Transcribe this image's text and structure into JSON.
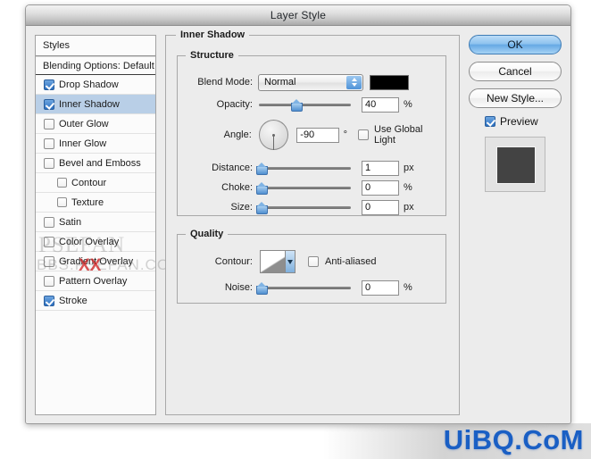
{
  "window": {
    "title": "Layer Style"
  },
  "sidebar": {
    "header": "Styles",
    "blending_options": "Blending Options: Default",
    "items": [
      {
        "label": "Drop Shadow",
        "checked": true,
        "selected": false,
        "indent": false
      },
      {
        "label": "Inner Shadow",
        "checked": true,
        "selected": true,
        "indent": false
      },
      {
        "label": "Outer Glow",
        "checked": false,
        "selected": false,
        "indent": false
      },
      {
        "label": "Inner Glow",
        "checked": false,
        "selected": false,
        "indent": false
      },
      {
        "label": "Bevel and Emboss",
        "checked": false,
        "selected": false,
        "indent": false
      },
      {
        "label": "Contour",
        "checked": false,
        "selected": false,
        "indent": true
      },
      {
        "label": "Texture",
        "checked": false,
        "selected": false,
        "indent": true
      },
      {
        "label": "Satin",
        "checked": false,
        "selected": false,
        "indent": false
      },
      {
        "label": "Color Overlay",
        "checked": false,
        "selected": false,
        "indent": false
      },
      {
        "label": "Gradient Overlay",
        "checked": false,
        "selected": false,
        "indent": false
      },
      {
        "label": "Pattern Overlay",
        "checked": false,
        "selected": false,
        "indent": false
      },
      {
        "label": "Stroke",
        "checked": true,
        "selected": false,
        "indent": false
      }
    ]
  },
  "panel": {
    "title": "Inner Shadow",
    "structure": {
      "legend": "Structure",
      "blend_mode_label": "Blend Mode:",
      "blend_mode_value": "Normal",
      "shadow_color": "#000000",
      "opacity_label": "Opacity:",
      "opacity_value": "40",
      "opacity_unit": "%",
      "opacity_percent": 40,
      "angle_label": "Angle:",
      "angle_value": "-90",
      "angle_unit": "°",
      "angle_degrees": -90,
      "use_global_light_label": "Use Global Light",
      "use_global_light_checked": false,
      "distance_label": "Distance:",
      "distance_value": "1",
      "distance_unit": "px",
      "distance_percent": 0,
      "choke_label": "Choke:",
      "choke_value": "0",
      "choke_unit": "%",
      "choke_percent": 0,
      "size_label": "Size:",
      "size_value": "0",
      "size_unit": "px",
      "size_percent": 0
    },
    "quality": {
      "legend": "Quality",
      "contour_label": "Contour:",
      "anti_aliased_label": "Anti-aliased",
      "anti_aliased_checked": false,
      "noise_label": "Noise:",
      "noise_value": "0",
      "noise_unit": "%",
      "noise_percent": 0
    }
  },
  "buttons": {
    "ok": "OK",
    "cancel": "Cancel",
    "new_style": "New Style...",
    "preview_label": "Preview",
    "preview_checked": true
  },
  "watermarks": {
    "ps_text": "PSEFAN",
    "bbs_text": "BBS.PSEFAN.COM",
    "xx_text": "XX",
    "site": "UiBQ.CoM"
  },
  "colors": {
    "accent": "#4f8fd0",
    "selection": "#b9cfe7",
    "dialog_bg": "#ececec",
    "watermark_blue": "#1a5fc4"
  }
}
